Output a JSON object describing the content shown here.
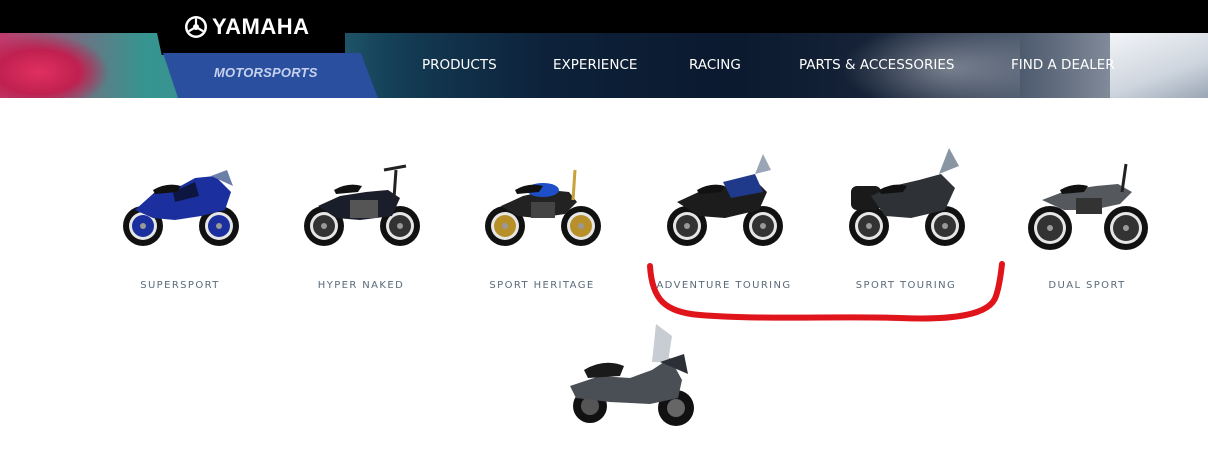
{
  "header": {
    "brand_name": "YAMAHA",
    "brand_sub": "MOTORSPORTS",
    "nav": [
      {
        "label": "PRODUCTS"
      },
      {
        "label": "EXPERIENCE"
      },
      {
        "label": "RACING"
      },
      {
        "label": "PARTS & ACCESSORIES"
      },
      {
        "label": "FIND A DEALER"
      }
    ]
  },
  "categories": [
    {
      "label": "SUPERSPORT",
      "color": "#1b2f9e"
    },
    {
      "label": "HYPER NAKED",
      "color": "#1a1d2a"
    },
    {
      "label": "SPORT HERITAGE",
      "color": "#1f4fc8"
    },
    {
      "label": "ADVENTURE TOURING",
      "color": "#1f3a8a"
    },
    {
      "label": "SPORT TOURING",
      "color": "#2e3236"
    },
    {
      "label": "DUAL SPORT",
      "color": "#55595e"
    }
  ],
  "extra_vehicle": {
    "type": "scooter-image",
    "color": "#4a4f56"
  },
  "annotation": {
    "color": "#e0141b"
  }
}
